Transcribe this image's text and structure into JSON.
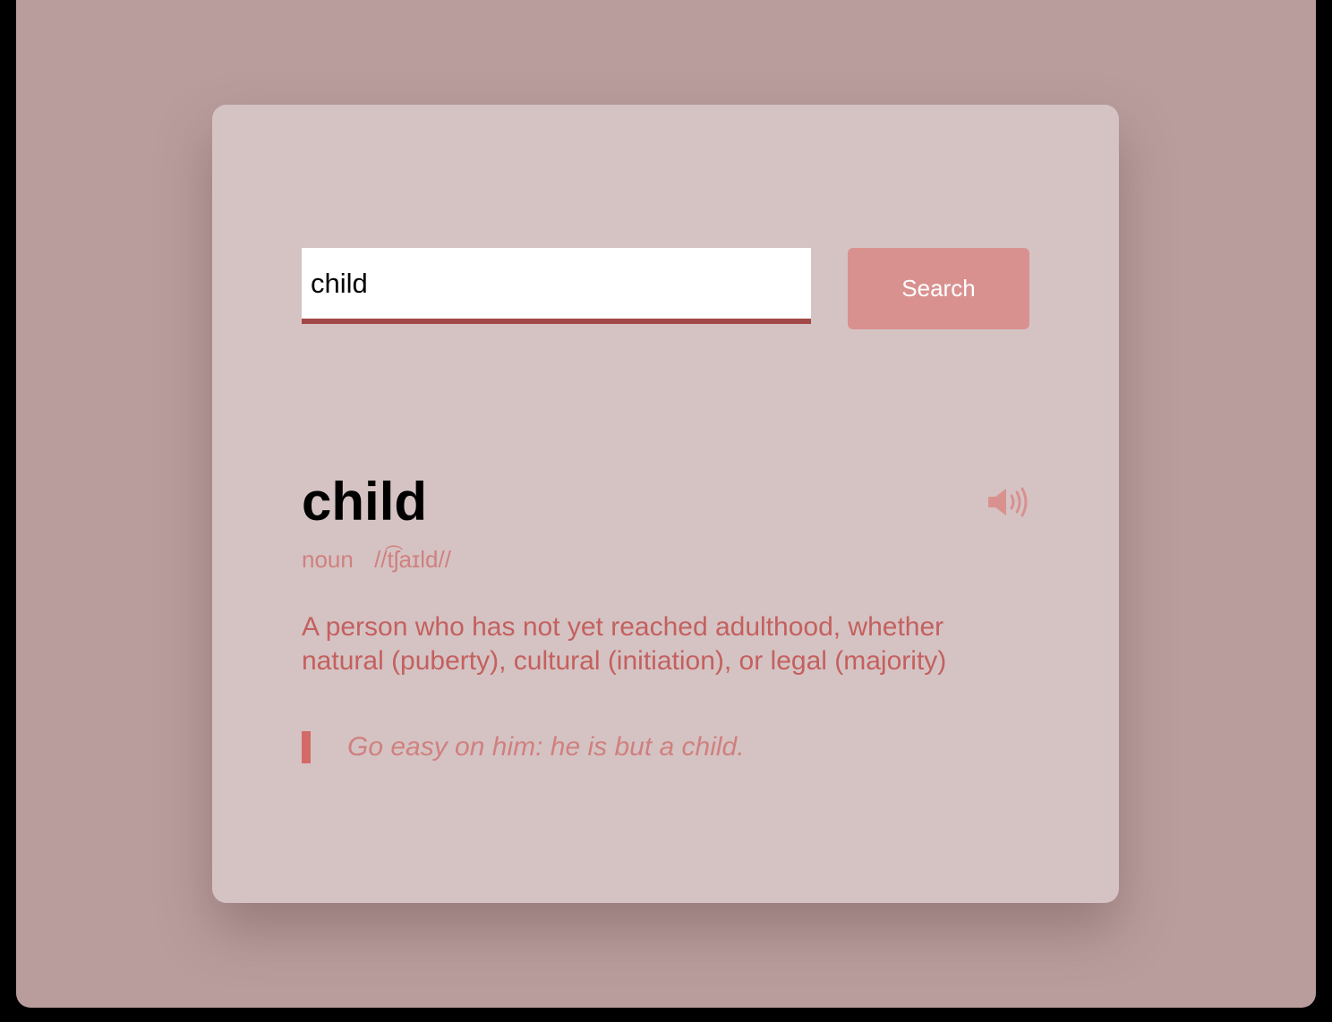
{
  "search": {
    "value": "child",
    "button_label": "Search"
  },
  "entry": {
    "word": "child",
    "part_of_speech": "noun",
    "phonetic": "//t͡ʃaɪld//",
    "definition": "A person who has not yet reached adulthood, whether natural (puberty), cultural (initiation), or legal (majority)",
    "example": "Go easy on him: he is but a child.",
    "audio_icon": "speaker-icon"
  },
  "colors": {
    "background": "#b99d9c",
    "card": "#d5c3c3",
    "accent": "#d99190",
    "input_underline": "#a34848",
    "definition_text": "#c4605f",
    "meta_text": "#d0807f",
    "example_bar": "#d36a67"
  }
}
